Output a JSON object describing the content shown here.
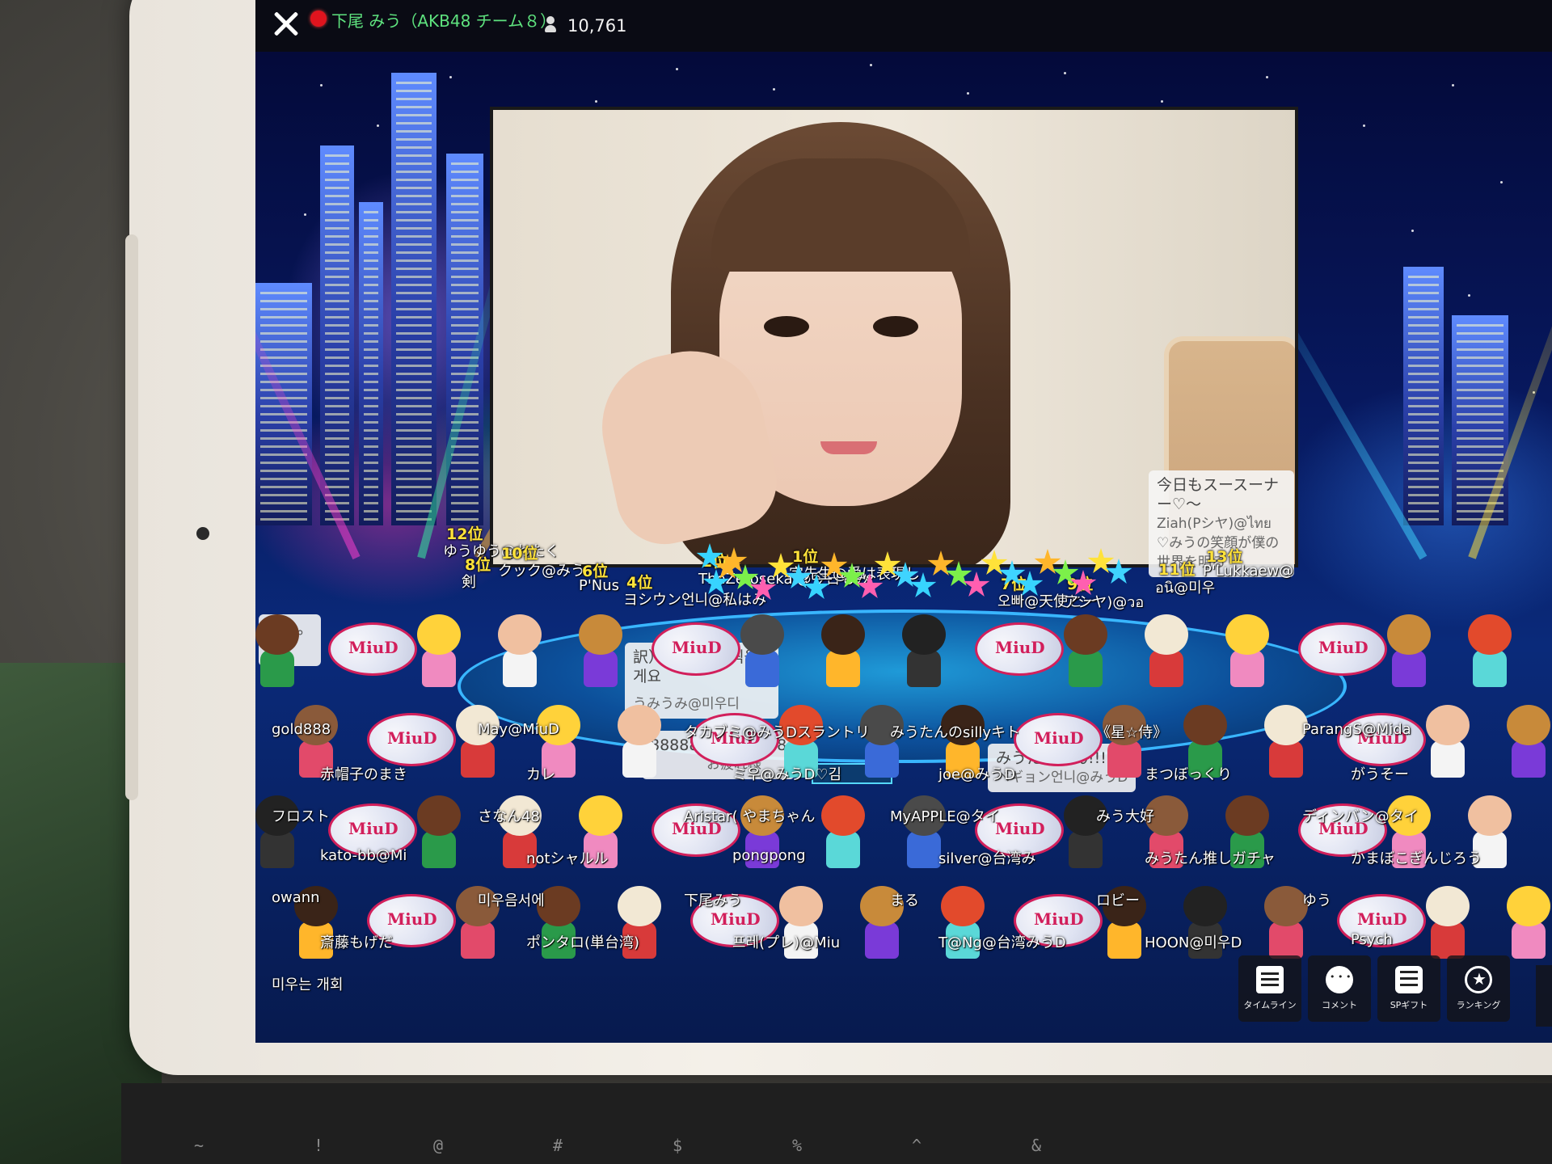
{
  "topbar": {
    "streamer_name": "下尾 みう（AKB48 チーム８）",
    "viewer_count": "10,761",
    "live_color": "#e0141e"
  },
  "overlay_comments": {
    "top_right": {
      "message": "今日もスースーナー♡～",
      "user": "Ziah(Pシヤ)@ไทย",
      "user_message": "♡みうの笑顔が僕の世界を明る"
    },
    "korean": {
      "message": "訳）그럼 사진 찍을게요",
      "user": "うみうみ@미우디"
    },
    "eights": {
      "message": "88888888888888",
      "sub": "お疲れ様"
    },
    "miutan": {
      "message": "みうたんたん!!!!!!",
      "sub": "ベギョン언니@みうD"
    },
    "left_edge": {
      "message": "イト。"
    }
  },
  "rankings": [
    {
      "rank": "12位",
      "name": "ゆうゆう@わたく"
    },
    {
      "rank": "10位",
      "name": "クック@みう"
    },
    {
      "rank": "8位",
      "name": "剣"
    },
    {
      "rank": "6位",
      "name": "P'Nus"
    },
    {
      "rank": "4位",
      "name": "ヨシウン언니@私はみ"
    },
    {
      "rank": "2位",
      "name": "TheZerosekai@今日もみ"
    },
    {
      "rank": "1位",
      "name": "字先生@愛は表現し"
    },
    {
      "rank": "7位",
      "name": "오빠@天使とー"
    },
    {
      "rank": "9位",
      "name": "アシヤ)@วอ"
    },
    {
      "rank": "11位",
      "name": "อนิ@미우"
    },
    {
      "rank": "13位",
      "name": "P'Lukkaew@"
    }
  ],
  "crowd_labels": [
    "gold888",
    "May@MiuD",
    "タカブミ@みうDスラントリ",
    "みうたんのsillyキト",
    "《星☆侍》",
    "ParangS@Mida",
    "赤帽子のまき",
    "カレ",
    "ミ우@みうD♡김",
    "joe@みうD",
    "まつぼっくり",
    "がうそー",
    "フロスト",
    "さなん48",
    "Aristar( やまちゃん",
    "MyAPPLE@タイ",
    "みう大好",
    "ディンバン@タイ",
    "kato-bb@Mi",
    "notシャルル",
    "pongpong",
    "silver@台湾み",
    "みうたん推しガチャ",
    "かまぼこぎんじろう",
    "owann",
    "미우음서에",
    "下尾みう",
    "まる",
    "ロビー",
    "ゆう",
    "斎藤もげだ",
    "ポンタロ(単台湾)",
    "프레(プレ)@Miu",
    "T@Ng@台湾みうD",
    "HOON@미우D",
    "Psych",
    "미우는 개회"
  ],
  "toolbar": {
    "timeline_label": "タイムライン",
    "comment_label": "コメント",
    "spgift_label": "SPギフト",
    "ranking_label": "ランキング"
  },
  "keyboard_glyphs": [
    "~",
    "!",
    "@",
    "#",
    "$",
    "%",
    "^",
    "&"
  ],
  "colors": {
    "rank_yellow": "#ffe23a",
    "stage_blue": "#1f9ad8",
    "fish_accent": "#d21f5b"
  }
}
